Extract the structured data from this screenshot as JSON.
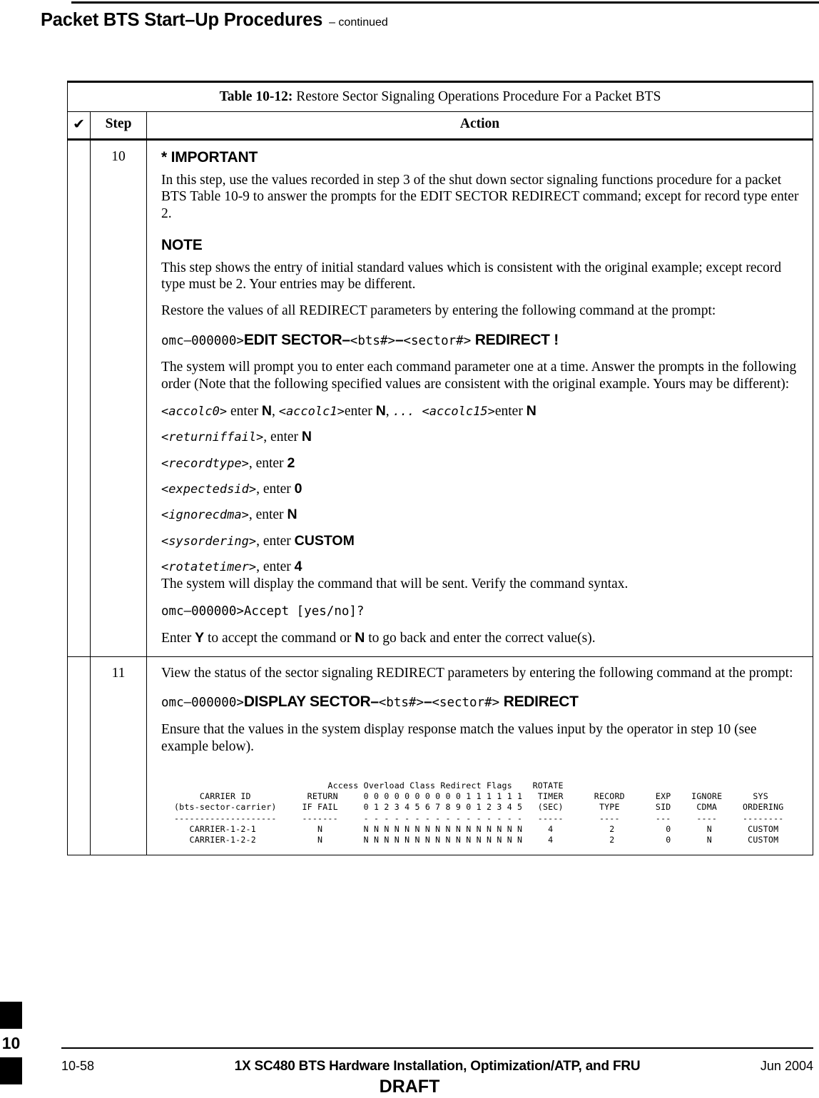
{
  "running_head": {
    "title": "Packet BTS Start–Up Procedures",
    "continued": "– continued"
  },
  "table": {
    "caption_label": "Table 10-12:",
    "caption_text": " Restore Sector Signaling Operations Procedure For a Packet BTS",
    "columns": {
      "check": "✔",
      "step": "Step",
      "action": "Action"
    },
    "rows": [
      {
        "step": "",
        "important_heading": "* IMPORTANT",
        "important_text": "In this step, use the values recorded in step 3 of the shut down sector signaling functions procedure for a packet BTS Table 10-9 to answer the prompts for the EDIT SECTOR REDIRECT command; except for record type enter 2.",
        "note_heading": "NOTE",
        "note_text": "This step shows the entry of initial standard values which is consistent with the original example; except record type must be 2. Your entries may be different.",
        "step_number": "10",
        "step_intro": "Restore the values of all REDIRECT parameters by entering the following command at the prompt:",
        "command": {
          "prompt": "omc–000000>",
          "verb": "EDIT SECTOR–",
          "arg1": "<bts#>",
          "dash": "–",
          "arg2": "<sector#>",
          "tail": " REDIRECT !"
        },
        "prompt_explain": "The system will prompt you to enter each command parameter one at a time. Answer the prompts in the following order (Note that the following specified values are consistent with the original example. Yours may be different):",
        "params": [
          {
            "segments": [
              {
                "type": "name",
                "text": "<accolc0>"
              },
              {
                "type": "plain",
                "text": " enter "
              },
              {
                "type": "val",
                "text": "N"
              },
              {
                "type": "plain",
                "text": ", "
              },
              {
                "type": "name",
                "text": "<accolc1>"
              },
              {
                "type": "plain",
                "text": "enter "
              },
              {
                "type": "val",
                "text": "N"
              },
              {
                "type": "plain",
                "text": ", "
              },
              {
                "type": "name",
                "text": "... "
              },
              {
                "type": "name",
                "text": "<accolc15>"
              },
              {
                "type": "plain",
                "text": "enter "
              },
              {
                "type": "val",
                "text": "N"
              }
            ]
          },
          {
            "segments": [
              {
                "type": "name",
                "text": "<returniffail>"
              },
              {
                "type": "plain",
                "text": ", enter "
              },
              {
                "type": "val",
                "text": "N"
              }
            ]
          },
          {
            "segments": [
              {
                "type": "name",
                "text": "<recordtype>"
              },
              {
                "type": "plain",
                "text": ", enter "
              },
              {
                "type": "val",
                "text": "2"
              }
            ]
          },
          {
            "segments": [
              {
                "type": "name",
                "text": "<expectedsid>"
              },
              {
                "type": "plain",
                "text": ", enter "
              },
              {
                "type": "val",
                "text": "0"
              }
            ]
          },
          {
            "segments": [
              {
                "type": "name",
                "text": "<ignorecdma>"
              },
              {
                "type": "plain",
                "text": ", enter "
              },
              {
                "type": "val",
                "text": "N"
              }
            ]
          },
          {
            "segments": [
              {
                "type": "name",
                "text": "<sysordering>"
              },
              {
                "type": "plain",
                "text": ", enter "
              },
              {
                "type": "val",
                "text": "CUSTOM"
              }
            ]
          },
          {
            "segments": [
              {
                "type": "name",
                "text": "<rotatetimer>"
              },
              {
                "type": "plain",
                "text": ", enter "
              },
              {
                "type": "val",
                "text": "4"
              }
            ]
          }
        ],
        "verify_text": "The system will display the command that will be sent. Verify the command syntax.",
        "accept_line": "omc–000000>Accept [yes/no]?",
        "accept_prefix": "Enter ",
        "accept_yes": "Y",
        "accept_mid": " to accept the command or ",
        "accept_no": "N",
        "accept_suffix": " to go back and enter the correct value(s)."
      },
      {
        "step_number": "11",
        "step_intro": "View the status of the sector signaling REDIRECT parameters by entering the following command at the prompt:",
        "command": {
          "prompt": "omc–000000>",
          "verb": "DISPLAY SECTOR–",
          "arg1": "<bts#>",
          "dash": "–",
          "arg2": "<sector#>",
          "tail": " REDIRECT"
        },
        "ensure_text": "Ensure that the values in the system display response match the values input by the operator in step 10 (see example below)."
      }
    ]
  },
  "system_listing": {
    "lines": [
      "                              Access Overload Class Redirect Flags    ROTATE",
      "     CARRIER ID           RETURN     0 0 0 0 0 0 0 0 0 0 1 1 1 1 1 1   TIMER      RECORD      EXP    IGNORE      SYS",
      "(bts-sector-carrier)     IF FAIL     0 1 2 3 4 5 6 7 8 9 0 1 2 3 4 5   (SEC)       TYPE       SID     CDMA     ORDERING",
      "--------------------     -------     - - - - - - - - - - - - - - - -   -----       ----       ---     ----     --------",
      "   CARRIER-1-2-1            N        N N N N N N N N N N N N N N N N     4           2          0       N       CUSTOM",
      "   CARRIER-1-2-2            N        N N N N N N N N N N N N N N N N     4           2          0       N       CUSTOM"
    ]
  },
  "chapter_tab": {
    "number": "10"
  },
  "footer": {
    "page": "10-58",
    "title": "1X SC480 BTS Hardware Installation, Optimization/ATP, and FRU",
    "date": "Jun 2004",
    "draft": "DRAFT"
  }
}
